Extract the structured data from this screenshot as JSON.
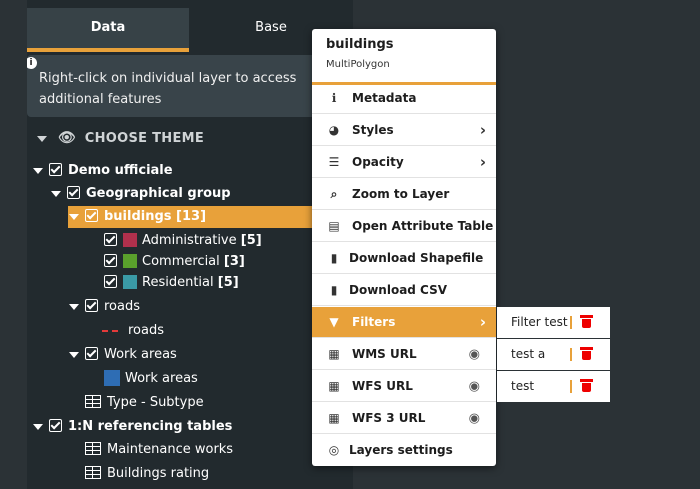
{
  "tabs": {
    "data": "Data",
    "base": "Base"
  },
  "info": {
    "icon": "info-icon",
    "text": "Right-click on individual layer to access additional features"
  },
  "theme": {
    "label": "CHOOSE THEME",
    "icon": "eye-icon"
  },
  "tree": {
    "root": "Demo ufficiale",
    "group": "Geographical group",
    "buildings": "buildings [13]",
    "categories": [
      {
        "label": "Administrative",
        "count": "[5]",
        "color": "#b0304c"
      },
      {
        "label": "Commercial",
        "count": "[3]",
        "color": "#5aa02c"
      },
      {
        "label": "Residential",
        "count": "[5]",
        "color": "#3a9aa6"
      }
    ],
    "roads": "roads",
    "roads_legend": "roads",
    "work_areas": "Work areas",
    "work_areas_legend": "Work areas",
    "work_areas_color": "#2e6db4",
    "type_subtype": "Type - Subtype",
    "referencing": "1:N referencing tables",
    "maintenance": "Maintenance works",
    "rating": "Buildings rating"
  },
  "menu": {
    "title": "buildings",
    "subtitle": "MultiPolygon",
    "items": [
      {
        "label": "Metadata",
        "icon": "info-icon"
      },
      {
        "label": "Styles",
        "icon": "palette-icon"
      },
      {
        "label": "Opacity",
        "icon": "sliders-icon"
      },
      {
        "label": "Zoom to Layer",
        "icon": "search-icon"
      },
      {
        "label": "Open Attribute Table",
        "icon": "table-icon"
      },
      {
        "label": "Download Shapefile",
        "icon": "file-download-icon"
      },
      {
        "label": "Download CSV",
        "icon": "csv-file-icon"
      },
      {
        "label": "Filters",
        "icon": "filter-icon"
      },
      {
        "label": "WMS URL",
        "icon": "map-icon"
      },
      {
        "label": "WFS URL",
        "icon": "map-icon"
      },
      {
        "label": "WFS 3 URL",
        "icon": "map-icon"
      },
      {
        "label": "Layers settings",
        "icon": "layers-settings-icon"
      }
    ]
  },
  "submenu": [
    {
      "label": "Filter test"
    },
    {
      "label": "test a"
    },
    {
      "label": "test"
    }
  ],
  "colors": {
    "accent": "#e8a13a",
    "panel": "#222a2e",
    "delete": "#e00000"
  }
}
